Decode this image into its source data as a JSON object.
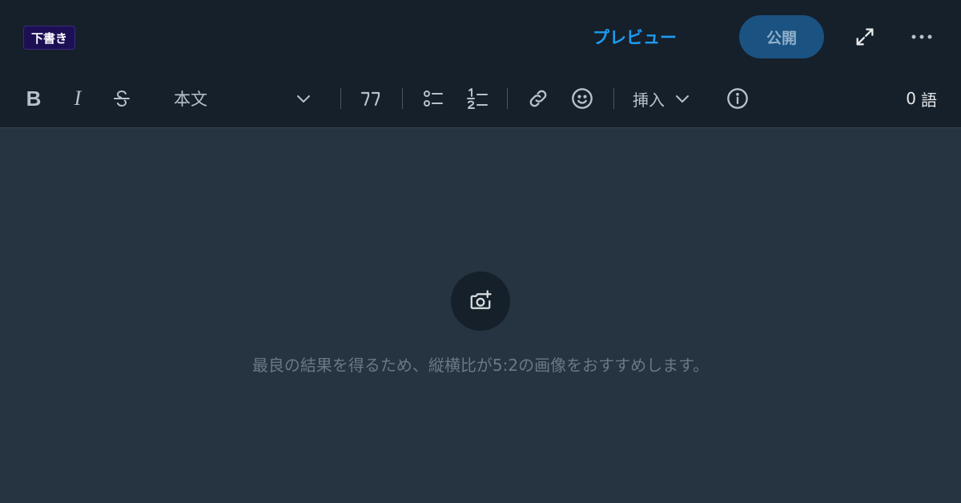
{
  "header": {
    "draft_badge": "下書き",
    "preview_label": "プレビュー",
    "publish_label": "公開"
  },
  "toolbar": {
    "bold_label": "B",
    "italic_label": "I",
    "text_style_selected": "本文",
    "insert_label": "挿入",
    "word_count": "0",
    "word_count_unit": "語"
  },
  "cover": {
    "hint": "最良の結果を得るため、縦横比が5:2の画像をおすすめします。"
  },
  "icons": {
    "expand": "expand-icon",
    "more": "more-icon",
    "strikethrough": "strikethrough-icon",
    "quote": "quote-icon",
    "bullet_list": "bullet-list-icon",
    "numbered_list": "numbered-list-icon",
    "link": "link-icon",
    "emoji": "emoji-icon",
    "info": "info-icon",
    "add_photo": "add-photo-icon"
  },
  "colors": {
    "accent": "#1d9bf0",
    "publish_bg": "#1a5281",
    "header_bg": "#15202b",
    "canvas_bg": "#263340",
    "draft_badge_bg": "#1d0f54"
  }
}
